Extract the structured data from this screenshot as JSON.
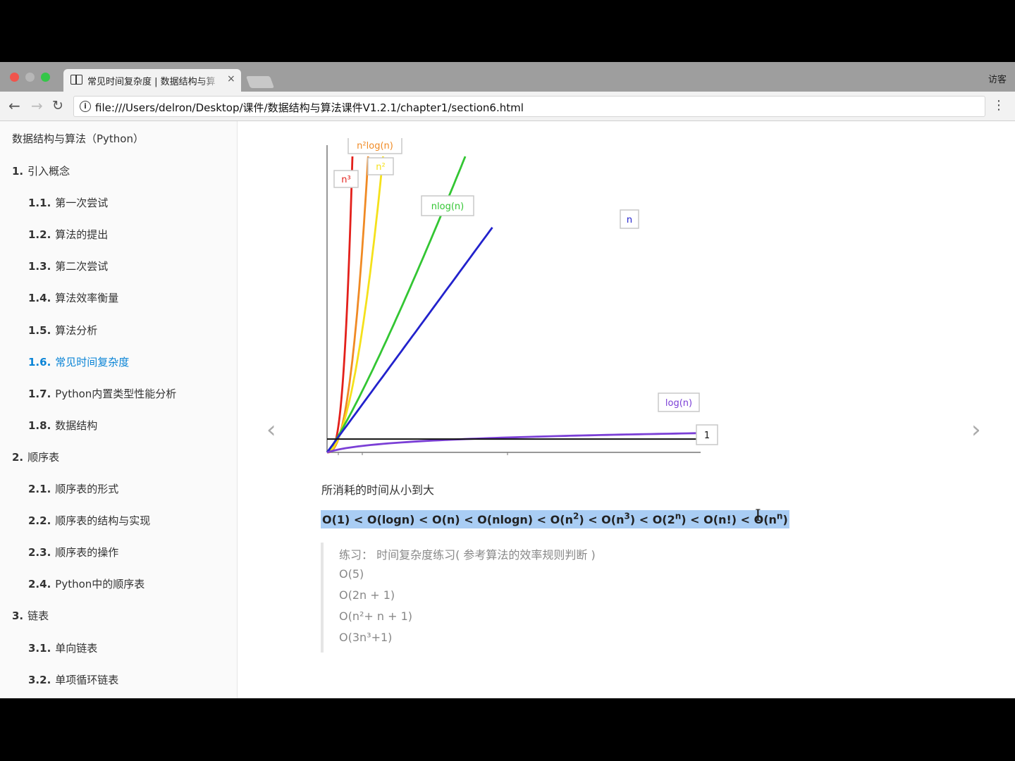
{
  "browser": {
    "tab_title": "常见时间复杂度 | 数据结构与算",
    "tab_close": "×",
    "user_label": "访客",
    "url": "file:///Users/delron/Desktop/课件/数据结构与算法课件V1.2.1/chapter1/section6.html"
  },
  "sidebar": {
    "title": "数据结构与算法（Python）",
    "items": [
      {
        "num": "1.",
        "label": "引入概念",
        "level": 1
      },
      {
        "num": "1.1.",
        "label": "第一次尝试",
        "level": 2
      },
      {
        "num": "1.2.",
        "label": "算法的提出",
        "level": 2
      },
      {
        "num": "1.3.",
        "label": "第二次尝试",
        "level": 2
      },
      {
        "num": "1.4.",
        "label": "算法效率衡量",
        "level": 2
      },
      {
        "num": "1.5.",
        "label": "算法分析",
        "level": 2
      },
      {
        "num": "1.6.",
        "label": "常见时间复杂度",
        "level": 2,
        "active": true
      },
      {
        "num": "1.7.",
        "label": "Python内置类型性能分析",
        "level": 2
      },
      {
        "num": "1.8.",
        "label": "数据结构",
        "level": 2
      },
      {
        "num": "2.",
        "label": "顺序表",
        "level": 1
      },
      {
        "num": "2.1.",
        "label": "顺序表的形式",
        "level": 2
      },
      {
        "num": "2.2.",
        "label": "顺序表的结构与实现",
        "level": 2
      },
      {
        "num": "2.3.",
        "label": "顺序表的操作",
        "level": 2
      },
      {
        "num": "2.4.",
        "label": "Python中的顺序表",
        "level": 2
      },
      {
        "num": "3.",
        "label": "链表",
        "level": 1
      },
      {
        "num": "3.1.",
        "label": "单向链表",
        "level": 2
      },
      {
        "num": "3.2.",
        "label": "单项循环链表",
        "level": 2
      }
    ]
  },
  "content": {
    "caption": "所消耗的时间从小到大",
    "complexity_order": "O(1) < O(logn) < O(n) < O(nlogn) < O(n2) < O(n3) < O(2n) < O(n!) < O(nn)",
    "exercise": {
      "heading": "练习：  时间复杂度练习( 参考算法的效率规则判断 )",
      "lines": [
        "O(5)",
        "O(2n + 1)",
        "O(n²+ n + 1)",
        "O(3n³+1)"
      ]
    },
    "prev_arrow": "‹",
    "next_arrow": "›"
  },
  "chart_data": {
    "type": "line",
    "title": "",
    "xlabel": "",
    "ylabel": "",
    "series": [
      {
        "name": "n³",
        "color": "#e3201b",
        "shape": "cubic"
      },
      {
        "name": "n²log(n)",
        "color": "#f08a24",
        "shape": "n2logn"
      },
      {
        "name": "n²",
        "color": "#f5e11b",
        "shape": "quadratic"
      },
      {
        "name": "nlog(n)",
        "color": "#33c633",
        "shape": "nlogn"
      },
      {
        "name": "n",
        "color": "#2222cc",
        "shape": "linear"
      },
      {
        "name": "log(n)",
        "color": "#7b3fd6",
        "shape": "logarithmic"
      },
      {
        "name": "1",
        "color": "#111111",
        "shape": "constant"
      }
    ],
    "grid": false,
    "legend": "inline labels at curve ends"
  }
}
